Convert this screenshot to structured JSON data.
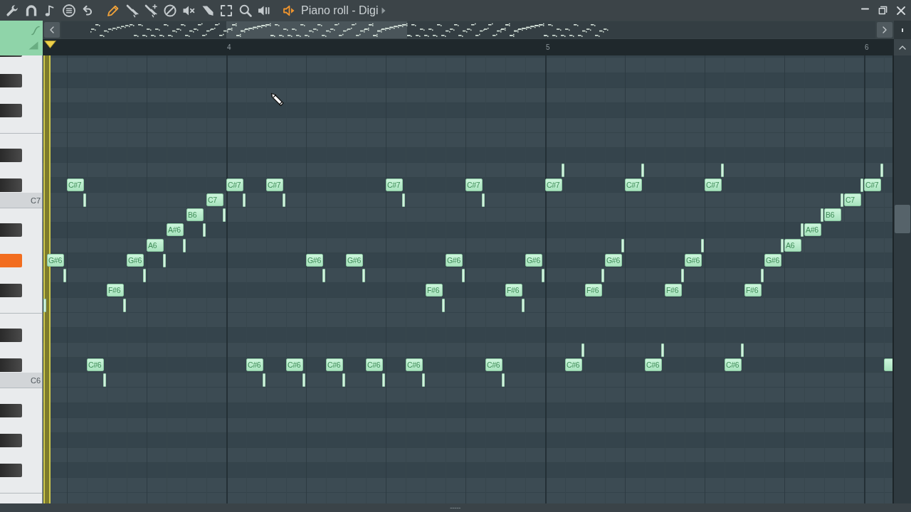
{
  "window": {
    "title": "Piano roll - Digi"
  },
  "toolbar": {
    "tools": [
      {
        "selected": true
      },
      {
        "selected": false
      },
      {
        "selected": false
      },
      {
        "selected": false
      },
      {
        "selected": false
      },
      {
        "selected": false
      },
      {
        "selected": false
      },
      {
        "selected": false
      },
      {
        "selected": false
      }
    ]
  },
  "timeline": {
    "steps": [
      {
        "kind": "step"
      },
      {
        "kind": "playhead"
      },
      {
        "kind": "step"
      },
      {
        "kind": "step"
      },
      {
        "kind": "step"
      },
      {
        "kind": "step"
      },
      {
        "kind": "step"
      },
      {
        "kind": "step"
      },
      {
        "kind": "step"
      },
      {
        "kind": "step"
      },
      {
        "kind": "bar",
        "label": "4"
      },
      {
        "kind": "step"
      },
      {
        "kind": "step"
      },
      {
        "kind": "step"
      },
      {
        "kind": "step"
      },
      {
        "kind": "step"
      },
      {
        "kind": "step"
      },
      {
        "kind": "step"
      },
      {
        "kind": "step"
      },
      {
        "kind": "step"
      },
      {
        "kind": "step"
      },
      {
        "kind": "step"
      },
      {
        "kind": "step"
      },
      {
        "kind": "step"
      },
      {
        "kind": "step"
      },
      {
        "kind": "step"
      },
      {
        "kind": "bar",
        "label": "5"
      },
      {
        "kind": "step"
      },
      {
        "kind": "step"
      },
      {
        "kind": "step"
      },
      {
        "kind": "step"
      },
      {
        "kind": "step"
      },
      {
        "kind": "step"
      },
      {
        "kind": "step"
      },
      {
        "kind": "step"
      },
      {
        "kind": "step"
      },
      {
        "kind": "step"
      },
      {
        "kind": "step"
      },
      {
        "kind": "step"
      },
      {
        "kind": "step"
      },
      {
        "kind": "step"
      },
      {
        "kind": "step"
      },
      {
        "kind": "bar",
        "label": "6"
      },
      {
        "kind": "step"
      }
    ]
  },
  "rows": [
    {
      "kind": "black",
      "pressed": false
    },
    {
      "kind": "white",
      "pressed": false
    },
    {
      "kind": "black",
      "pressed": false
    },
    {
      "kind": "white",
      "pressed": false
    },
    {
      "kind": "black",
      "pressed": false
    },
    {
      "kind": "white",
      "pressed": false
    },
    {
      "kind": "white",
      "pressed": false
    },
    {
      "kind": "black",
      "pressed": false
    },
    {
      "kind": "white",
      "pressed": false,
      "steps": [
        {
          "kind": "rest"
        },
        {
          "kind": "rest"
        },
        {
          "kind": "rest"
        },
        {
          "kind": "rest"
        },
        {
          "kind": "rest"
        },
        {
          "kind": "rest"
        },
        {
          "kind": "rest"
        },
        {
          "kind": "rest"
        },
        {
          "kind": "rest"
        },
        {
          "kind": "rest"
        },
        {
          "kind": "rest"
        },
        {
          "kind": "rest"
        },
        {
          "kind": "rest"
        },
        {
          "kind": "rest"
        },
        {
          "kind": "rest"
        },
        {
          "kind": "rest"
        },
        {
          "kind": "rest"
        },
        {
          "kind": "rest"
        },
        {
          "kind": "rest"
        },
        {
          "kind": "rest"
        },
        {
          "kind": "rest"
        },
        {
          "kind": "rest"
        },
        {
          "kind": "rest"
        },
        {
          "kind": "rest"
        },
        {
          "kind": "rest"
        },
        {
          "kind": "rest"
        },
        {
          "kind": "short"
        },
        {
          "kind": "rest"
        },
        {
          "kind": "rest"
        },
        {
          "kind": "rest"
        },
        {
          "kind": "short"
        },
        {
          "kind": "rest"
        },
        {
          "kind": "rest"
        },
        {
          "kind": "rest"
        },
        {
          "kind": "short"
        },
        {
          "kind": "rest"
        },
        {
          "kind": "rest"
        },
        {
          "kind": "rest"
        },
        {
          "kind": "rest"
        },
        {
          "kind": "rest"
        },
        {
          "kind": "rest"
        },
        {
          "kind": "rest"
        },
        {
          "kind": "short"
        },
        {
          "kind": "rest"
        }
      ]
    },
    {
      "kind": "black",
      "pressed": false,
      "steps": [
        {
          "kind": "rest"
        },
        {
          "kind": "rest"
        },
        {
          "kind": "note",
          "label": "C#7"
        },
        {
          "kind": "rest"
        },
        {
          "kind": "rest"
        },
        {
          "kind": "rest"
        },
        {
          "kind": "rest"
        },
        {
          "kind": "rest"
        },
        {
          "kind": "rest"
        },
        {
          "kind": "rest"
        },
        {
          "kind": "note",
          "label": "C#7"
        },
        {
          "kind": "rest"
        },
        {
          "kind": "note",
          "label": "C#7"
        },
        {
          "kind": "rest"
        },
        {
          "kind": "rest"
        },
        {
          "kind": "rest"
        },
        {
          "kind": "rest"
        },
        {
          "kind": "rest"
        },
        {
          "kind": "note",
          "label": "C#7"
        },
        {
          "kind": "rest"
        },
        {
          "kind": "rest"
        },
        {
          "kind": "rest"
        },
        {
          "kind": "note",
          "label": "C#7"
        },
        {
          "kind": "rest"
        },
        {
          "kind": "rest"
        },
        {
          "kind": "rest"
        },
        {
          "kind": "note",
          "label": "C#7"
        },
        {
          "kind": "rest"
        },
        {
          "kind": "rest"
        },
        {
          "kind": "rest"
        },
        {
          "kind": "note",
          "label": "C#7"
        },
        {
          "kind": "rest"
        },
        {
          "kind": "rest"
        },
        {
          "kind": "rest"
        },
        {
          "kind": "note",
          "label": "C#7"
        },
        {
          "kind": "rest"
        },
        {
          "kind": "rest"
        },
        {
          "kind": "rest"
        },
        {
          "kind": "rest"
        },
        {
          "kind": "rest"
        },
        {
          "kind": "rest"
        },
        {
          "kind": "short"
        },
        {
          "kind": "note",
          "label": "C#7"
        },
        {
          "kind": "rest"
        }
      ]
    },
    {
      "kind": "white",
      "pressed": false,
      "label": "C7",
      "steps": [
        {
          "kind": "rest"
        },
        {
          "kind": "rest"
        },
        {
          "kind": "short"
        },
        {
          "kind": "rest"
        },
        {
          "kind": "rest"
        },
        {
          "kind": "rest"
        },
        {
          "kind": "rest"
        },
        {
          "kind": "rest"
        },
        {
          "kind": "rest"
        },
        {
          "kind": "note",
          "label": "C7"
        },
        {
          "kind": "short"
        },
        {
          "kind": "rest"
        },
        {
          "kind": "short"
        },
        {
          "kind": "rest"
        },
        {
          "kind": "rest"
        },
        {
          "kind": "rest"
        },
        {
          "kind": "rest"
        },
        {
          "kind": "rest"
        },
        {
          "kind": "short"
        },
        {
          "kind": "rest"
        },
        {
          "kind": "rest"
        },
        {
          "kind": "rest"
        },
        {
          "kind": "short"
        },
        {
          "kind": "rest"
        },
        {
          "kind": "rest"
        },
        {
          "kind": "rest"
        },
        {
          "kind": "rest"
        },
        {
          "kind": "rest"
        },
        {
          "kind": "rest"
        },
        {
          "kind": "rest"
        },
        {
          "kind": "rest"
        },
        {
          "kind": "rest"
        },
        {
          "kind": "rest"
        },
        {
          "kind": "rest"
        },
        {
          "kind": "rest"
        },
        {
          "kind": "rest"
        },
        {
          "kind": "rest"
        },
        {
          "kind": "rest"
        },
        {
          "kind": "rest"
        },
        {
          "kind": "rest"
        },
        {
          "kind": "short"
        },
        {
          "kind": "note",
          "label": "C7"
        },
        {
          "kind": "rest"
        },
        {
          "kind": "rest"
        }
      ]
    },
    {
      "kind": "white",
      "pressed": false,
      "steps": [
        {
          "kind": "rest"
        },
        {
          "kind": "rest"
        },
        {
          "kind": "rest"
        },
        {
          "kind": "rest"
        },
        {
          "kind": "rest"
        },
        {
          "kind": "rest"
        },
        {
          "kind": "rest"
        },
        {
          "kind": "rest"
        },
        {
          "kind": "note",
          "label": "B6"
        },
        {
          "kind": "short"
        },
        {
          "kind": "rest"
        },
        {
          "kind": "rest"
        },
        {
          "kind": "rest"
        },
        {
          "kind": "rest"
        },
        {
          "kind": "rest"
        },
        {
          "kind": "rest"
        },
        {
          "kind": "rest"
        },
        {
          "kind": "rest"
        },
        {
          "kind": "rest"
        },
        {
          "kind": "rest"
        },
        {
          "kind": "rest"
        },
        {
          "kind": "rest"
        },
        {
          "kind": "rest"
        },
        {
          "kind": "rest"
        },
        {
          "kind": "rest"
        },
        {
          "kind": "rest"
        },
        {
          "kind": "rest"
        },
        {
          "kind": "rest"
        },
        {
          "kind": "rest"
        },
        {
          "kind": "rest"
        },
        {
          "kind": "rest"
        },
        {
          "kind": "rest"
        },
        {
          "kind": "rest"
        },
        {
          "kind": "rest"
        },
        {
          "kind": "rest"
        },
        {
          "kind": "rest"
        },
        {
          "kind": "rest"
        },
        {
          "kind": "rest"
        },
        {
          "kind": "rest"
        },
        {
          "kind": "short"
        },
        {
          "kind": "note",
          "label": "B6"
        },
        {
          "kind": "rest"
        },
        {
          "kind": "rest"
        },
        {
          "kind": "rest"
        }
      ]
    },
    {
      "kind": "black",
      "pressed": false,
      "steps": [
        {
          "kind": "rest"
        },
        {
          "kind": "rest"
        },
        {
          "kind": "rest"
        },
        {
          "kind": "rest"
        },
        {
          "kind": "rest"
        },
        {
          "kind": "rest"
        },
        {
          "kind": "rest"
        },
        {
          "kind": "note",
          "label": "A#6"
        },
        {
          "kind": "short"
        },
        {
          "kind": "rest"
        },
        {
          "kind": "rest"
        },
        {
          "kind": "rest"
        },
        {
          "kind": "rest"
        },
        {
          "kind": "rest"
        },
        {
          "kind": "rest"
        },
        {
          "kind": "rest"
        },
        {
          "kind": "rest"
        },
        {
          "kind": "rest"
        },
        {
          "kind": "rest"
        },
        {
          "kind": "rest"
        },
        {
          "kind": "rest"
        },
        {
          "kind": "rest"
        },
        {
          "kind": "rest"
        },
        {
          "kind": "rest"
        },
        {
          "kind": "rest"
        },
        {
          "kind": "rest"
        },
        {
          "kind": "rest"
        },
        {
          "kind": "rest"
        },
        {
          "kind": "rest"
        },
        {
          "kind": "rest"
        },
        {
          "kind": "rest"
        },
        {
          "kind": "rest"
        },
        {
          "kind": "rest"
        },
        {
          "kind": "rest"
        },
        {
          "kind": "rest"
        },
        {
          "kind": "rest"
        },
        {
          "kind": "rest"
        },
        {
          "kind": "rest"
        },
        {
          "kind": "short"
        },
        {
          "kind": "note",
          "label": "A#6"
        },
        {
          "kind": "rest"
        },
        {
          "kind": "rest"
        },
        {
          "kind": "rest"
        },
        {
          "kind": "rest"
        }
      ]
    },
    {
      "kind": "white",
      "pressed": false,
      "steps": [
        {
          "kind": "rest"
        },
        {
          "kind": "rest"
        },
        {
          "kind": "rest"
        },
        {
          "kind": "rest"
        },
        {
          "kind": "rest"
        },
        {
          "kind": "rest"
        },
        {
          "kind": "note",
          "label": "A6"
        },
        {
          "kind": "short"
        },
        {
          "kind": "rest"
        },
        {
          "kind": "rest"
        },
        {
          "kind": "rest"
        },
        {
          "kind": "rest"
        },
        {
          "kind": "rest"
        },
        {
          "kind": "rest"
        },
        {
          "kind": "rest"
        },
        {
          "kind": "rest"
        },
        {
          "kind": "rest"
        },
        {
          "kind": "rest"
        },
        {
          "kind": "rest"
        },
        {
          "kind": "rest"
        },
        {
          "kind": "rest"
        },
        {
          "kind": "rest"
        },
        {
          "kind": "rest"
        },
        {
          "kind": "rest"
        },
        {
          "kind": "rest"
        },
        {
          "kind": "rest"
        },
        {
          "kind": "rest"
        },
        {
          "kind": "rest"
        },
        {
          "kind": "rest"
        },
        {
          "kind": "short"
        },
        {
          "kind": "rest"
        },
        {
          "kind": "rest"
        },
        {
          "kind": "rest"
        },
        {
          "kind": "short"
        },
        {
          "kind": "rest"
        },
        {
          "kind": "rest"
        },
        {
          "kind": "rest"
        },
        {
          "kind": "short"
        },
        {
          "kind": "note",
          "label": "A6"
        },
        {
          "kind": "rest"
        },
        {
          "kind": "rest"
        },
        {
          "kind": "rest"
        },
        {
          "kind": "rest"
        },
        {
          "kind": "rest"
        }
      ]
    },
    {
      "kind": "black",
      "pressed": true,
      "steps": [
        {
          "kind": "rest"
        },
        {
          "kind": "note",
          "label": "G#6"
        },
        {
          "kind": "rest"
        },
        {
          "kind": "rest"
        },
        {
          "kind": "rest"
        },
        {
          "kind": "note",
          "label": "G#6"
        },
        {
          "kind": "short"
        },
        {
          "kind": "rest"
        },
        {
          "kind": "rest"
        },
        {
          "kind": "rest"
        },
        {
          "kind": "rest"
        },
        {
          "kind": "rest"
        },
        {
          "kind": "rest"
        },
        {
          "kind": "rest"
        },
        {
          "kind": "note",
          "label": "G#6"
        },
        {
          "kind": "rest"
        },
        {
          "kind": "note",
          "label": "G#6"
        },
        {
          "kind": "rest"
        },
        {
          "kind": "rest"
        },
        {
          "kind": "rest"
        },
        {
          "kind": "rest"
        },
        {
          "kind": "note",
          "label": "G#6"
        },
        {
          "kind": "rest"
        },
        {
          "kind": "rest"
        },
        {
          "kind": "rest"
        },
        {
          "kind": "note",
          "label": "G#6"
        },
        {
          "kind": "rest"
        },
        {
          "kind": "rest"
        },
        {
          "kind": "rest"
        },
        {
          "kind": "note",
          "label": "G#6"
        },
        {
          "kind": "rest"
        },
        {
          "kind": "rest"
        },
        {
          "kind": "rest"
        },
        {
          "kind": "note",
          "label": "G#6"
        },
        {
          "kind": "rest"
        },
        {
          "kind": "rest"
        },
        {
          "kind": "rest"
        },
        {
          "kind": "note",
          "label": "G#6"
        },
        {
          "kind": "rest"
        },
        {
          "kind": "rest"
        },
        {
          "kind": "rest"
        },
        {
          "kind": "rest"
        },
        {
          "kind": "rest"
        },
        {
          "kind": "rest"
        }
      ]
    },
    {
      "kind": "white",
      "pressed": false,
      "steps": [
        {
          "kind": "rest"
        },
        {
          "kind": "short"
        },
        {
          "kind": "rest"
        },
        {
          "kind": "rest"
        },
        {
          "kind": "rest"
        },
        {
          "kind": "short"
        },
        {
          "kind": "rest"
        },
        {
          "kind": "rest"
        },
        {
          "kind": "rest"
        },
        {
          "kind": "rest"
        },
        {
          "kind": "rest"
        },
        {
          "kind": "rest"
        },
        {
          "kind": "rest"
        },
        {
          "kind": "rest"
        },
        {
          "kind": "short"
        },
        {
          "kind": "rest"
        },
        {
          "kind": "short"
        },
        {
          "kind": "rest"
        },
        {
          "kind": "rest"
        },
        {
          "kind": "rest"
        },
        {
          "kind": "rest"
        },
        {
          "kind": "short"
        },
        {
          "kind": "rest"
        },
        {
          "kind": "rest"
        },
        {
          "kind": "rest"
        },
        {
          "kind": "short"
        },
        {
          "kind": "rest"
        },
        {
          "kind": "rest"
        },
        {
          "kind": "short"
        },
        {
          "kind": "rest"
        },
        {
          "kind": "rest"
        },
        {
          "kind": "rest"
        },
        {
          "kind": "short"
        },
        {
          "kind": "rest"
        },
        {
          "kind": "rest"
        },
        {
          "kind": "rest"
        },
        {
          "kind": "short"
        },
        {
          "kind": "rest"
        },
        {
          "kind": "rest"
        },
        {
          "kind": "rest"
        },
        {
          "kind": "rest"
        },
        {
          "kind": "rest"
        },
        {
          "kind": "rest"
        },
        {
          "kind": "rest"
        }
      ]
    },
    {
      "kind": "black",
      "pressed": false,
      "steps": [
        {
          "kind": "rest"
        },
        {
          "kind": "rest"
        },
        {
          "kind": "rest"
        },
        {
          "kind": "rest"
        },
        {
          "kind": "note",
          "label": "F#6"
        },
        {
          "kind": "rest"
        },
        {
          "kind": "rest"
        },
        {
          "kind": "rest"
        },
        {
          "kind": "rest"
        },
        {
          "kind": "rest"
        },
        {
          "kind": "rest"
        },
        {
          "kind": "rest"
        },
        {
          "kind": "rest"
        },
        {
          "kind": "rest"
        },
        {
          "kind": "rest"
        },
        {
          "kind": "rest"
        },
        {
          "kind": "rest"
        },
        {
          "kind": "rest"
        },
        {
          "kind": "rest"
        },
        {
          "kind": "rest"
        },
        {
          "kind": "note",
          "label": "F#6"
        },
        {
          "kind": "rest"
        },
        {
          "kind": "rest"
        },
        {
          "kind": "rest"
        },
        {
          "kind": "note",
          "label": "F#6"
        },
        {
          "kind": "rest"
        },
        {
          "kind": "rest"
        },
        {
          "kind": "rest"
        },
        {
          "kind": "note",
          "label": "F#6"
        },
        {
          "kind": "rest"
        },
        {
          "kind": "rest"
        },
        {
          "kind": "rest"
        },
        {
          "kind": "note",
          "label": "F#6"
        },
        {
          "kind": "rest"
        },
        {
          "kind": "rest"
        },
        {
          "kind": "rest"
        },
        {
          "kind": "note",
          "label": "F#6"
        },
        {
          "kind": "rest"
        },
        {
          "kind": "rest"
        },
        {
          "kind": "rest"
        },
        {
          "kind": "rest"
        },
        {
          "kind": "rest"
        },
        {
          "kind": "rest"
        },
        {
          "kind": "rest"
        }
      ]
    },
    {
      "kind": "white",
      "pressed": false,
      "steps": [
        {
          "kind": "short"
        },
        {
          "kind": "rest"
        },
        {
          "kind": "rest"
        },
        {
          "kind": "rest"
        },
        {
          "kind": "short"
        },
        {
          "kind": "rest"
        },
        {
          "kind": "rest"
        },
        {
          "kind": "rest"
        },
        {
          "kind": "rest"
        },
        {
          "kind": "rest"
        },
        {
          "kind": "rest"
        },
        {
          "kind": "rest"
        },
        {
          "kind": "rest"
        },
        {
          "kind": "rest"
        },
        {
          "kind": "rest"
        },
        {
          "kind": "rest"
        },
        {
          "kind": "rest"
        },
        {
          "kind": "rest"
        },
        {
          "kind": "rest"
        },
        {
          "kind": "rest"
        },
        {
          "kind": "short"
        },
        {
          "kind": "rest"
        },
        {
          "kind": "rest"
        },
        {
          "kind": "rest"
        },
        {
          "kind": "short"
        },
        {
          "kind": "rest"
        },
        {
          "kind": "rest"
        },
        {
          "kind": "rest"
        },
        {
          "kind": "rest"
        },
        {
          "kind": "rest"
        },
        {
          "kind": "rest"
        },
        {
          "kind": "rest"
        },
        {
          "kind": "rest"
        },
        {
          "kind": "rest"
        },
        {
          "kind": "rest"
        },
        {
          "kind": "rest"
        },
        {
          "kind": "rest"
        },
        {
          "kind": "rest"
        },
        {
          "kind": "rest"
        },
        {
          "kind": "rest"
        },
        {
          "kind": "rest"
        },
        {
          "kind": "rest"
        },
        {
          "kind": "rest"
        },
        {
          "kind": "rest"
        }
      ]
    },
    {
      "kind": "white",
      "pressed": false
    },
    {
      "kind": "black",
      "pressed": false
    },
    {
      "kind": "white",
      "pressed": false,
      "steps": [
        {
          "kind": "rest"
        },
        {
          "kind": "rest"
        },
        {
          "kind": "rest"
        },
        {
          "kind": "rest"
        },
        {
          "kind": "rest"
        },
        {
          "kind": "rest"
        },
        {
          "kind": "rest"
        },
        {
          "kind": "rest"
        },
        {
          "kind": "rest"
        },
        {
          "kind": "rest"
        },
        {
          "kind": "rest"
        },
        {
          "kind": "rest"
        },
        {
          "kind": "rest"
        },
        {
          "kind": "rest"
        },
        {
          "kind": "rest"
        },
        {
          "kind": "rest"
        },
        {
          "kind": "rest"
        },
        {
          "kind": "rest"
        },
        {
          "kind": "rest"
        },
        {
          "kind": "rest"
        },
        {
          "kind": "rest"
        },
        {
          "kind": "rest"
        },
        {
          "kind": "rest"
        },
        {
          "kind": "rest"
        },
        {
          "kind": "rest"
        },
        {
          "kind": "rest"
        },
        {
          "kind": "rest"
        },
        {
          "kind": "short"
        },
        {
          "kind": "rest"
        },
        {
          "kind": "rest"
        },
        {
          "kind": "rest"
        },
        {
          "kind": "short"
        },
        {
          "kind": "rest"
        },
        {
          "kind": "rest"
        },
        {
          "kind": "rest"
        },
        {
          "kind": "short"
        },
        {
          "kind": "rest"
        },
        {
          "kind": "rest"
        },
        {
          "kind": "rest"
        },
        {
          "kind": "rest"
        },
        {
          "kind": "rest"
        },
        {
          "kind": "rest"
        },
        {
          "kind": "rest"
        },
        {
          "kind": "rest"
        }
      ]
    },
    {
      "kind": "black",
      "pressed": false,
      "steps": [
        {
          "kind": "rest"
        },
        {
          "kind": "rest"
        },
        {
          "kind": "rest"
        },
        {
          "kind": "note",
          "label": "C#6"
        },
        {
          "kind": "rest"
        },
        {
          "kind": "rest"
        },
        {
          "kind": "rest"
        },
        {
          "kind": "rest"
        },
        {
          "kind": "rest"
        },
        {
          "kind": "rest"
        },
        {
          "kind": "rest"
        },
        {
          "kind": "note",
          "label": "C#6"
        },
        {
          "kind": "rest"
        },
        {
          "kind": "note",
          "label": "C#6"
        },
        {
          "kind": "rest"
        },
        {
          "kind": "note",
          "label": "C#6"
        },
        {
          "kind": "rest"
        },
        {
          "kind": "note",
          "label": "C#6"
        },
        {
          "kind": "rest"
        },
        {
          "kind": "note",
          "label": "C#6"
        },
        {
          "kind": "rest"
        },
        {
          "kind": "rest"
        },
        {
          "kind": "rest"
        },
        {
          "kind": "note",
          "label": "C#6"
        },
        {
          "kind": "rest"
        },
        {
          "kind": "rest"
        },
        {
          "kind": "rest"
        },
        {
          "kind": "note",
          "label": "C#6"
        },
        {
          "kind": "rest"
        },
        {
          "kind": "rest"
        },
        {
          "kind": "rest"
        },
        {
          "kind": "note",
          "label": "C#6"
        },
        {
          "kind": "rest"
        },
        {
          "kind": "rest"
        },
        {
          "kind": "rest"
        },
        {
          "kind": "note",
          "label": "C#6"
        },
        {
          "kind": "rest"
        },
        {
          "kind": "rest"
        },
        {
          "kind": "rest"
        },
        {
          "kind": "rest"
        },
        {
          "kind": "rest"
        },
        {
          "kind": "rest"
        },
        {
          "kind": "rest"
        },
        {
          "kind": "note"
        }
      ]
    },
    {
      "kind": "white",
      "pressed": false,
      "label": "C6",
      "steps": [
        {
          "kind": "rest"
        },
        {
          "kind": "rest"
        },
        {
          "kind": "rest"
        },
        {
          "kind": "short"
        },
        {
          "kind": "rest"
        },
        {
          "kind": "rest"
        },
        {
          "kind": "rest"
        },
        {
          "kind": "rest"
        },
        {
          "kind": "rest"
        },
        {
          "kind": "rest"
        },
        {
          "kind": "rest"
        },
        {
          "kind": "short"
        },
        {
          "kind": "rest"
        },
        {
          "kind": "short"
        },
        {
          "kind": "rest"
        },
        {
          "kind": "short"
        },
        {
          "kind": "rest"
        },
        {
          "kind": "short"
        },
        {
          "kind": "rest"
        },
        {
          "kind": "short"
        },
        {
          "kind": "rest"
        },
        {
          "kind": "rest"
        },
        {
          "kind": "rest"
        },
        {
          "kind": "short"
        },
        {
          "kind": "rest"
        },
        {
          "kind": "rest"
        },
        {
          "kind": "rest"
        },
        {
          "kind": "rest"
        },
        {
          "kind": "rest"
        },
        {
          "kind": "rest"
        },
        {
          "kind": "rest"
        },
        {
          "kind": "rest"
        },
        {
          "kind": "rest"
        },
        {
          "kind": "rest"
        },
        {
          "kind": "rest"
        },
        {
          "kind": "rest"
        },
        {
          "kind": "rest"
        },
        {
          "kind": "rest"
        },
        {
          "kind": "rest"
        },
        {
          "kind": "rest"
        },
        {
          "kind": "rest"
        },
        {
          "kind": "rest"
        },
        {
          "kind": "rest"
        },
        {
          "kind": "rest"
        }
      ]
    },
    {
      "kind": "white",
      "pressed": false
    },
    {
      "kind": "black",
      "pressed": false
    },
    {
      "kind": "white",
      "pressed": false
    },
    {
      "kind": "black",
      "pressed": false
    },
    {
      "kind": "white",
      "pressed": false
    },
    {
      "kind": "black",
      "pressed": false
    },
    {
      "kind": "white",
      "pressed": false
    },
    {
      "kind": "white",
      "pressed": false
    }
  ]
}
